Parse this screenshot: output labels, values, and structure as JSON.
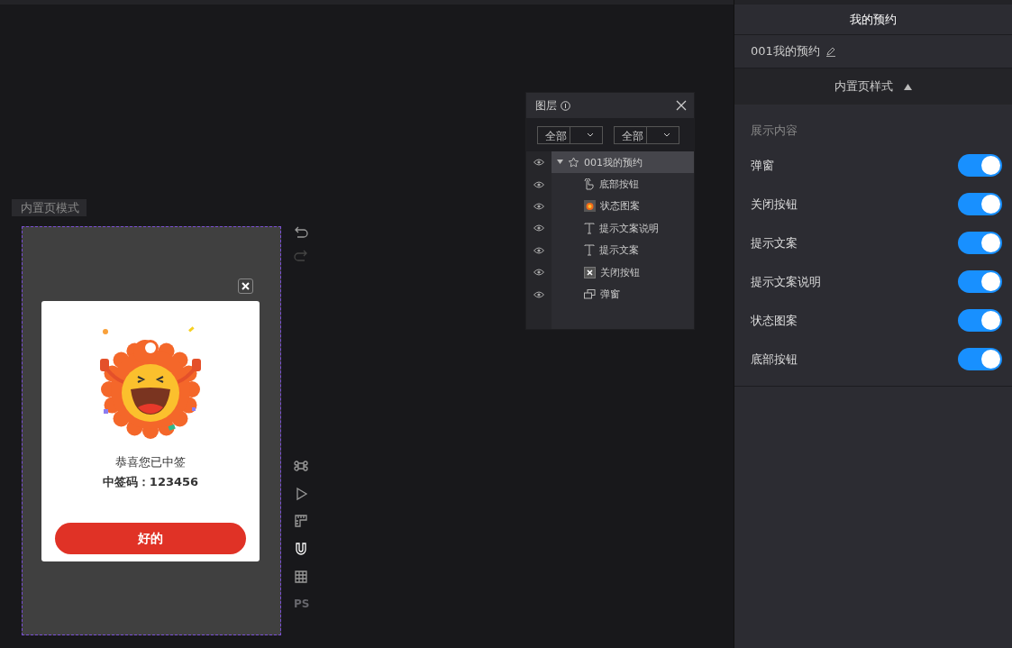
{
  "canvas": {
    "mode_tab": "内置页模式",
    "popup": {
      "close_visible": true,
      "title": "恭喜您已中签",
      "code": "中签码：123456",
      "button": "好的"
    },
    "ps_label": "PS"
  },
  "layers_panel": {
    "title": "图层",
    "filters": [
      "全部",
      "全部"
    ],
    "root": {
      "label": "001我的预约",
      "expanded": true,
      "selected": true,
      "visible": true,
      "children": [
        {
          "label": "底部按钮",
          "kind": "hand",
          "selected": false,
          "visible": true
        },
        {
          "label": "状态图案",
          "kind": "image",
          "selected": false,
          "visible": true
        },
        {
          "label": "提示文案说明",
          "kind": "text",
          "selected": false,
          "visible": true
        },
        {
          "label": "提示文案",
          "kind": "text",
          "selected": false,
          "visible": true
        },
        {
          "label": "关闭按钮",
          "kind": "close",
          "selected": false,
          "visible": true
        },
        {
          "label": "弹窗",
          "kind": "popup",
          "selected": false,
          "visible": true
        }
      ]
    }
  },
  "right_panel": {
    "title": "我的预约",
    "name": "001我的预约",
    "section": {
      "title": "内置页样式",
      "expanded": true
    },
    "group_label": "展示内容",
    "toggles": [
      {
        "label": "弹窗",
        "on": true
      },
      {
        "label": "关闭按钮",
        "on": true
      },
      {
        "label": "提示文案",
        "on": true
      },
      {
        "label": "提示文案说明",
        "on": true
      },
      {
        "label": "状态图案",
        "on": true
      },
      {
        "label": "底部按钮",
        "on": true
      }
    ]
  }
}
